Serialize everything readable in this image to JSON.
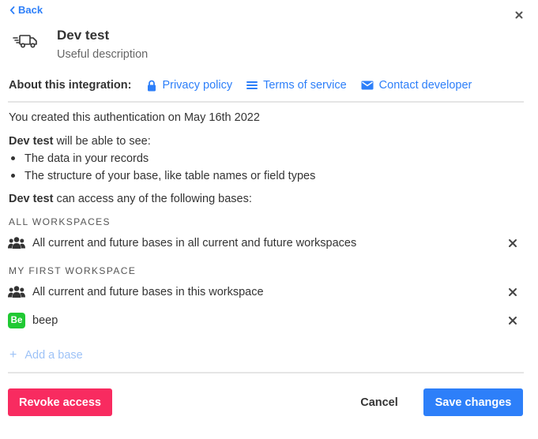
{
  "header": {
    "back_label": "Back",
    "app_icon": "delivery-truck-icon",
    "title": "Dev test",
    "description": "Useful description"
  },
  "about": {
    "label": "About this integration:",
    "links": [
      {
        "label": "Privacy policy",
        "icon": "lock-icon"
      },
      {
        "label": "Terms of service",
        "icon": "list-lines-icon"
      },
      {
        "label": "Contact developer",
        "icon": "envelope-icon"
      }
    ]
  },
  "created_text": "You created this authentication on May 16th 2022",
  "permissions": {
    "app_name": "Dev test",
    "heading_suffix": " will be able to see:",
    "items": [
      "The data in your records",
      "The structure of your base, like table names or field types"
    ]
  },
  "access": {
    "app_name": "Dev test",
    "heading_suffix": " can access any of the following bases:"
  },
  "workspaces": [
    {
      "label": "ALL WORKSPACES",
      "rows": [
        {
          "icon": "group-users-icon",
          "text": "All current and future bases in all current and future workspaces"
        }
      ]
    },
    {
      "label": "MY FIRST WORKSPACE",
      "rows": [
        {
          "icon": "group-users-icon",
          "text": "All current and future bases in this workspace"
        },
        {
          "icon": "base-badge",
          "badge": "Be",
          "text": "beep"
        }
      ]
    }
  ],
  "add_base_label": "Add a base",
  "footer": {
    "revoke_label": "Revoke access",
    "cancel_label": "Cancel",
    "save_label": "Save changes"
  },
  "colors": {
    "link_blue": "#2d7ff9",
    "revoke_red": "#f82b60",
    "badge_green": "#20c933",
    "add_base_blue_light": "#9ec3f7"
  }
}
